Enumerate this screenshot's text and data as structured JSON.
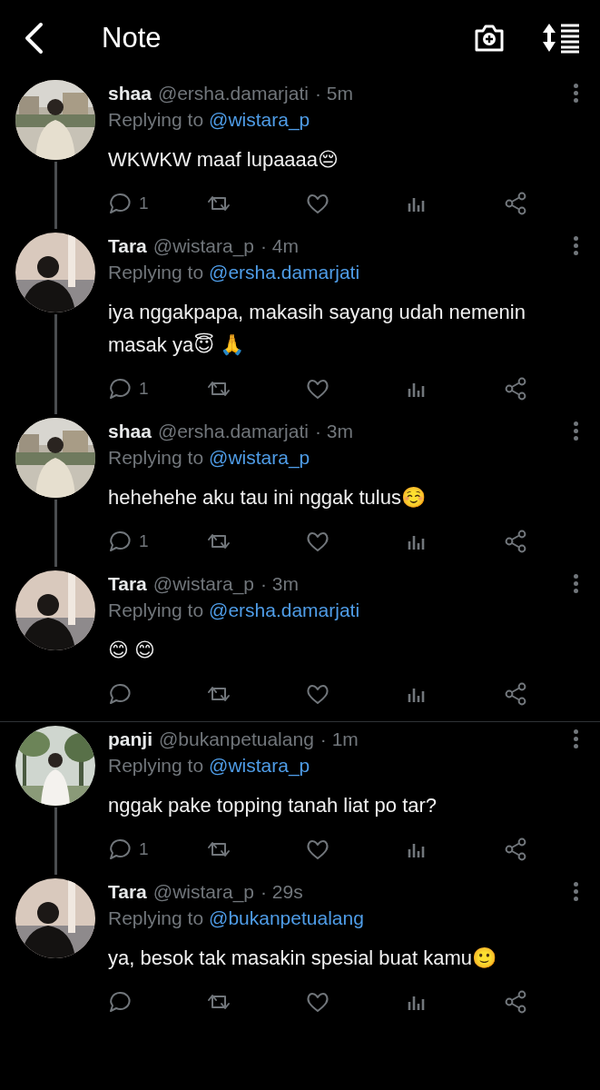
{
  "header": {
    "title": "Note"
  },
  "tweets": [
    {
      "name": "shaa",
      "handle": "@ersha.damarjati",
      "time": "· 5m",
      "replying_label": "Replying to",
      "mention": "@wistara_p",
      "text": "WKWKW maaf lupaaaa😔",
      "reply_count": "1",
      "thread_continues": true,
      "divider_after": false
    },
    {
      "name": "Tara",
      "handle": "@wistara_p",
      "time": "· 4m",
      "replying_label": "Replying to",
      "mention": "@ersha.damarjati",
      "text": "iya nggakpapa, makasih sayang udah nemenin masak ya😇 🙏",
      "reply_count": "1",
      "thread_continues": true,
      "divider_after": false
    },
    {
      "name": "shaa",
      "handle": "@ersha.damarjati",
      "time": "· 3m",
      "replying_label": "Replying to",
      "mention": "@wistara_p",
      "text": "hehehehe aku tau ini nggak tulus☺️",
      "reply_count": "1",
      "thread_continues": true,
      "divider_after": false
    },
    {
      "name": "Tara",
      "handle": "@wistara_p",
      "time": "· 3m",
      "replying_label": "Replying to",
      "mention": "@ersha.damarjati",
      "text": "😊 😊",
      "thread_continues": false,
      "divider_after": true
    },
    {
      "name": "panji",
      "handle": "@bukanpetualang",
      "time": "· 1m",
      "replying_label": "Replying to",
      "mention": "@wistara_p",
      "text": "nggak pake topping tanah liat po tar?",
      "reply_count": "1",
      "thread_continues": true,
      "divider_after": false
    },
    {
      "name": "Tara",
      "handle": "@wistara_p",
      "time": "· 29s",
      "replying_label": "Replying to",
      "mention": "@bukanpetualang",
      "text": "ya, besok tak masakin spesial buat kamu🙂",
      "thread_continues": false,
      "divider_after": false
    }
  ]
}
